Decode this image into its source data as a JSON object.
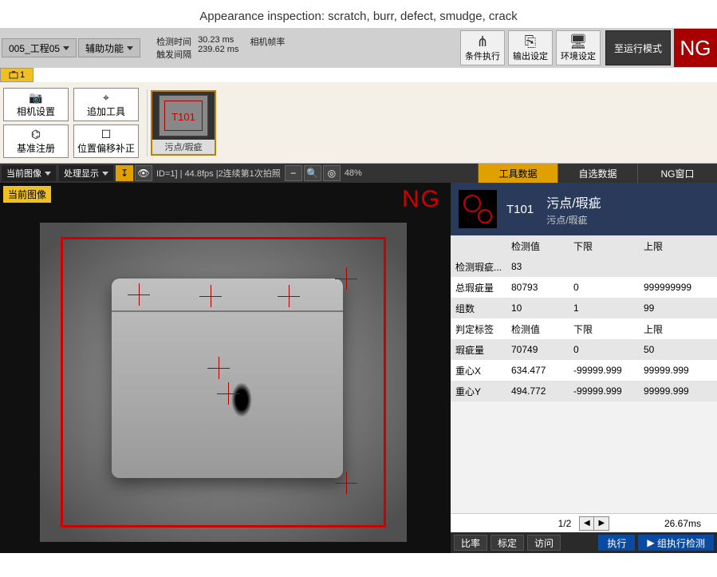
{
  "title": "Appearance inspection: scratch, burr, defect, smudge, crack",
  "top": {
    "project_dd": "005_工程05",
    "aux_dd": "辅助功能",
    "timing": {
      "detect_label": "检测时间",
      "detect_value": "30.23 ms",
      "trigger_label": "触发间隔",
      "trigger_value": "239.62 ms",
      "fps_label": "相机帧率"
    },
    "cond_exec": "条件执行",
    "out_set": "输出设定",
    "env_set": "环境设定",
    "run_mode": "至运行模式",
    "ng": "NG",
    "tab1": "1"
  },
  "tools": {
    "camera_set": "相机设置",
    "base_reg": "基准注册",
    "add_tool": "追加工具",
    "pos_offset": "位置偏移补正",
    "thumb_id": "T101",
    "thumb_label": "污点/瑕疵"
  },
  "status": {
    "current_img": "当前图像",
    "proc_disp": "处理显示",
    "info": "ID=1] | 44.8fps |2连续第1次拍照",
    "zoom": "48%"
  },
  "tabs": {
    "tool_data": "工具数据",
    "custom_data": "自选数据",
    "ng_window": "NG窗口"
  },
  "img_panel": {
    "tag": "当前图像",
    "ng": "NG"
  },
  "data_header": {
    "id": "T101",
    "title": "污点/瑕疵",
    "sub": "污点/瑕疵"
  },
  "data_table": {
    "head": {
      "c1": "检测值",
      "c2": "下限",
      "c3": "上限"
    },
    "rows": [
      {
        "c0": "检测瑕疵...",
        "c1": "83",
        "c2": "",
        "c3": ""
      },
      {
        "c0": "总瑕疵量",
        "c1": "80793",
        "c2": "0",
        "c3": "999999999"
      },
      {
        "c0": "组数",
        "c1": "10",
        "c2": "1",
        "c3": "99"
      },
      {
        "c0": "判定标签",
        "c1": "检测值",
        "c2": "下限",
        "c3": "上限"
      },
      {
        "c0": "瑕疵量",
        "c1": "70749",
        "c2": "0",
        "c3": "50"
      },
      {
        "c0": "重心X",
        "c1": "634.477",
        "c2": "-99999.999",
        "c3": "99999.999"
      },
      {
        "c0": "重心Y",
        "c1": "494.772",
        "c2": "-99999.999",
        "c3": "99999.999"
      }
    ]
  },
  "pager": {
    "page": "1/2",
    "time": "26.67ms"
  },
  "bottom": {
    "ratio": "比率",
    "calib": "标定",
    "access": "访问",
    "exec": "执行",
    "group_exec": "组执行检测"
  },
  "glyphs": {
    "cond": "⋔",
    "out": "⎘",
    "env": "🖥",
    "camera": "📷",
    "base": "⌬",
    "add": "⌖",
    "pos": "☐",
    "left": "◀",
    "right": "▶",
    "play": "▶",
    "dplay": "▶|",
    "import": "↧",
    "eye": "👁",
    "search": "🔍",
    "target": "◎"
  }
}
